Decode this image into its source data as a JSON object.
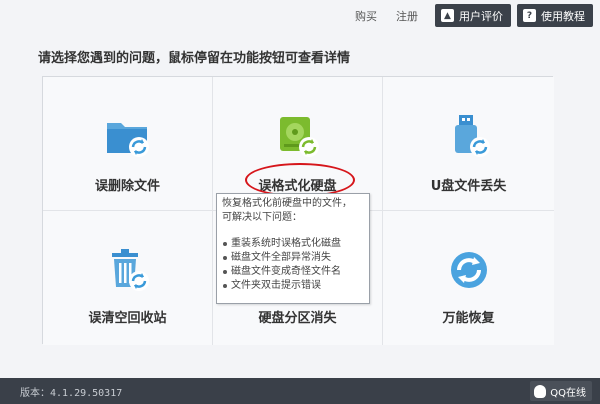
{
  "topbar": {
    "buy_label": "购买",
    "register_label": "注册",
    "user_review_label": "用户评价",
    "tutorial_label": "使用教程"
  },
  "prompt": "请选择您遇到的问题，鼠标停留在功能按钮可查看详情",
  "options": [
    {
      "label": "误删除文件",
      "icon": "folder-recover-icon"
    },
    {
      "label": "误格式化硬盘",
      "icon": "hard-drive-recover-icon"
    },
    {
      "label": "U盘文件丢失",
      "icon": "usb-drive-recover-icon"
    },
    {
      "label": "误清空回收站",
      "icon": "recycle-bin-recover-icon"
    },
    {
      "label": "硬盘分区消失",
      "icon": "partition-icon"
    },
    {
      "label": "万能恢复",
      "icon": "universal-recover-icon"
    }
  ],
  "tooltip": {
    "intro_line1": "恢复格式化前硬盘中的文件，",
    "intro_line2": "可解决以下问题：",
    "items": [
      "重装系统时误格式化磁盘",
      "磁盘文件全部异常消失",
      "磁盘文件变成奇怪文件名",
      "文件夹双击提示错误"
    ]
  },
  "footer": {
    "version": "版本：4.1.29.50317",
    "qq_label": "QQ在线"
  },
  "colors": {
    "accent_blue": "#3a9ad9",
    "accent_green": "#7cbb2e",
    "dark_bar": "#3a4049",
    "highlight_red": "#d6161b"
  }
}
